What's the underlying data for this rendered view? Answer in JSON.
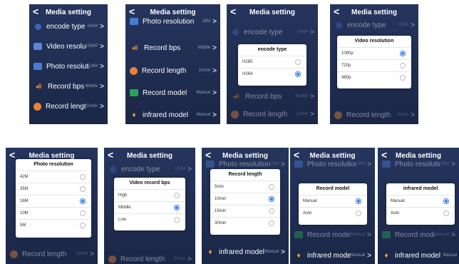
{
  "title": "Media setting",
  "back_glyph": "<",
  "arrow_glyph": ">",
  "labels": {
    "encode_type": "encode type",
    "video_resolution": "Video resolution",
    "photo_resolution": "Photo resolution",
    "record_bps": "Record bps",
    "record_length": "Record length",
    "record_model": "Record model",
    "infrared_model": "infrared model"
  },
  "values": {
    "encode_type": "H264",
    "video_resolution": "1080P",
    "photo_resolution": "16M",
    "record_bps": "Middle",
    "record_length": "10min",
    "record_model": "Manual",
    "infrared_model": "Manual"
  },
  "icons": {
    "encode_type": "chip-icon",
    "video_resolution": "video-icon",
    "photo_resolution": "photo-icon",
    "record_bps": "signal-icon",
    "record_length": "clock-icon",
    "record_model": "camera-icon",
    "infrared_model": "bulb-icon"
  },
  "dialogs": {
    "encode": {
      "title": "encode type",
      "options": [
        "H265",
        "H264"
      ],
      "selected": 1
    },
    "video": {
      "title": "Video resolution",
      "options": [
        "1080p",
        "720p",
        "480p"
      ],
      "selected": 0
    },
    "photo": {
      "title": "Photo resolution",
      "options": [
        "42M",
        "35M",
        "16M",
        "10M",
        "5M"
      ],
      "selected": 2
    },
    "bps": {
      "title": "Video record bps",
      "options": [
        "High",
        "Middle",
        "Low"
      ],
      "selected": 1
    },
    "length": {
      "title": "Record length",
      "options": [
        "5min",
        "10min",
        "15min",
        "30min"
      ],
      "selected": 1
    },
    "model": {
      "title": "Record model",
      "options": [
        "Manual",
        "Auto"
      ],
      "selected": 0
    },
    "infrared": {
      "title": "infrared model",
      "options": [
        "Manual",
        "Auto"
      ],
      "selected": 0
    }
  },
  "colors": {
    "panel_bg": "#25355d",
    "accent": "#2f7be6"
  }
}
